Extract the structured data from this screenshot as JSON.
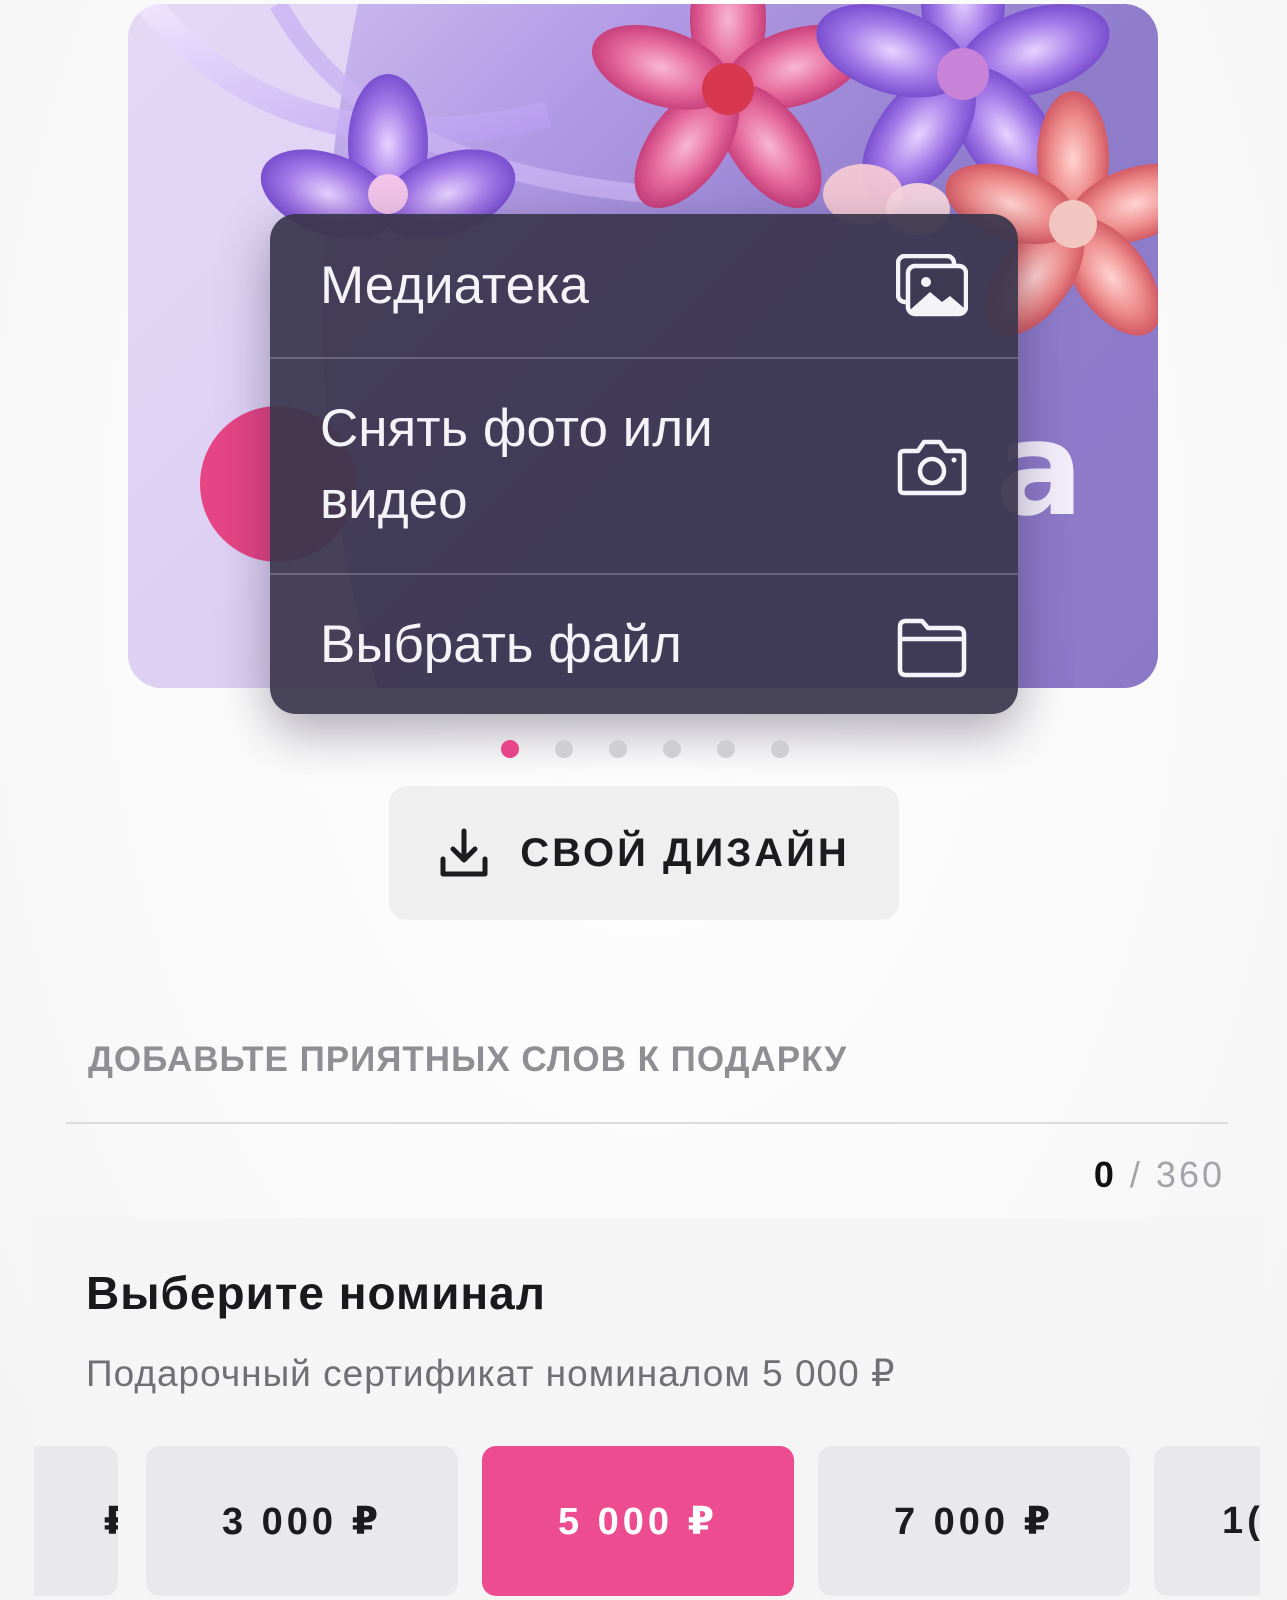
{
  "menu": {
    "items": [
      {
        "label": "Медиатека",
        "icon": "photo-library-icon"
      },
      {
        "label": "Снять фото или\nвидео",
        "icon": "camera-icon"
      },
      {
        "label": "Выбрать файл",
        "icon": "folder-icon"
      }
    ]
  },
  "carousel": {
    "dots_count": 6,
    "active_index": 0,
    "active_color": "#e6458a"
  },
  "own_design": {
    "label": "СВОЙ ДИЗАЙН",
    "icon": "download-icon"
  },
  "message": {
    "placeholder": "ДОБАВЬТЕ ПРИЯТНЫХ СЛОВ К ПОДАРКУ",
    "count_current": "0",
    "count_separator": "/",
    "count_max": "360"
  },
  "nominal": {
    "title": "Выберите номинал",
    "subtitle": "Подарочный сертификат номиналом 5 000 ₽",
    "options": [
      {
        "label": "₽",
        "selected": false
      },
      {
        "label": "3 000 ₽",
        "selected": false
      },
      {
        "label": "5 000 ₽",
        "selected": true
      },
      {
        "label": "7 000 ₽",
        "selected": false
      },
      {
        "label": "1(",
        "selected": false
      }
    ],
    "accent_color": "#ee4c91"
  }
}
